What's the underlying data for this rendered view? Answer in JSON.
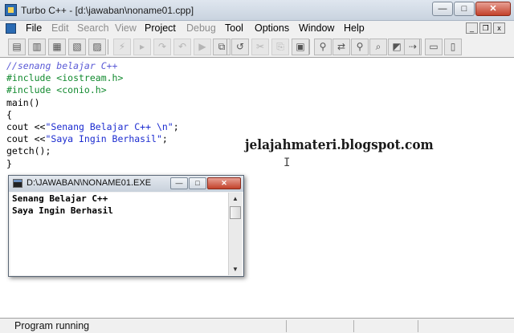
{
  "window": {
    "title": "Turbo C++ - [d:\\jawaban\\noname01.cpp]",
    "min": "—",
    "max": "□",
    "close": "✕"
  },
  "menu": {
    "items": [
      "File",
      "Edit",
      "Search",
      "View",
      "Project",
      "Debug",
      "Tool",
      "Options",
      "Window",
      "Help"
    ],
    "mdi_min": "_",
    "mdi_restore": "❐",
    "mdi_close": "x"
  },
  "toolbar": {
    "buttons": [
      {
        "name": "open-file-button",
        "glyph": "▤",
        "dim": false
      },
      {
        "name": "open-project-button",
        "glyph": "▥",
        "dim": false
      },
      {
        "name": "save-button",
        "glyph": "▦",
        "dim": false
      },
      {
        "name": "save-all-button",
        "glyph": "▧",
        "dim": false
      },
      {
        "name": "print-button",
        "glyph": "▨",
        "dim": false
      },
      {
        "name": "make-button",
        "glyph": "⚡",
        "dim": true
      },
      {
        "name": "build-button",
        "glyph": "▸",
        "dim": true
      },
      {
        "name": "step-over-button",
        "glyph": "↷",
        "dim": true
      },
      {
        "name": "trace-into-button",
        "glyph": "↶",
        "dim": true
      },
      {
        "name": "run-button",
        "glyph": "▶",
        "dim": true
      },
      {
        "name": "compile-button",
        "glyph": "⧉",
        "dim": false
      },
      {
        "name": "undo-button",
        "glyph": "↺",
        "dim": false
      },
      {
        "name": "cut-button",
        "glyph": "✂",
        "dim": true
      },
      {
        "name": "copy-button",
        "glyph": "⎘",
        "dim": true
      },
      {
        "name": "paste-button",
        "glyph": "▣",
        "dim": false
      },
      {
        "name": "search-button",
        "glyph": "⚲",
        "dim": false
      },
      {
        "name": "replace-button",
        "glyph": "⇄",
        "dim": false
      },
      {
        "name": "search-again-button",
        "glyph": "⚲",
        "dim": false
      },
      {
        "name": "find-button",
        "glyph": "⌕",
        "dim": false
      },
      {
        "name": "bookmark-button",
        "glyph": "◩",
        "dim": false
      },
      {
        "name": "goto-button",
        "glyph": "⇢",
        "dim": false
      },
      {
        "name": "message-window-button",
        "glyph": "▭",
        "dim": false
      },
      {
        "name": "project-window-button",
        "glyph": "▯",
        "dim": false
      }
    ]
  },
  "editor": {
    "lines": [
      {
        "kind": "comment",
        "text": "//senang belajar C++"
      },
      {
        "kind": "pre",
        "text": "#include <iostream.h>"
      },
      {
        "kind": "pre",
        "text": "#include <conio.h>"
      },
      {
        "kind": "plain",
        "text": "main()"
      },
      {
        "kind": "plain",
        "text": "{"
      },
      {
        "kind": "mixed",
        "a": "cout <<",
        "b": "\"Senang Belajar C++ \\n\"",
        "c": ";"
      },
      {
        "kind": "mixed",
        "a": "cout <<",
        "b": "\"Saya Ingin Berhasil\"",
        "c": ";"
      },
      {
        "kind": "plain",
        "text": "getch();"
      },
      {
        "kind": "plain",
        "text": "}"
      }
    ],
    "watermark": "jelajahmateri.blogspot.com"
  },
  "console": {
    "title": "D:\\JAWABAN\\NONAME01.EXE",
    "min": "—",
    "max": "□",
    "close": "✕",
    "output": "Senang Belajar C++\nSaya Ingin Berhasil",
    "scroll_up": "▲",
    "scroll_down": "▼"
  },
  "status": {
    "text": "Program running"
  }
}
